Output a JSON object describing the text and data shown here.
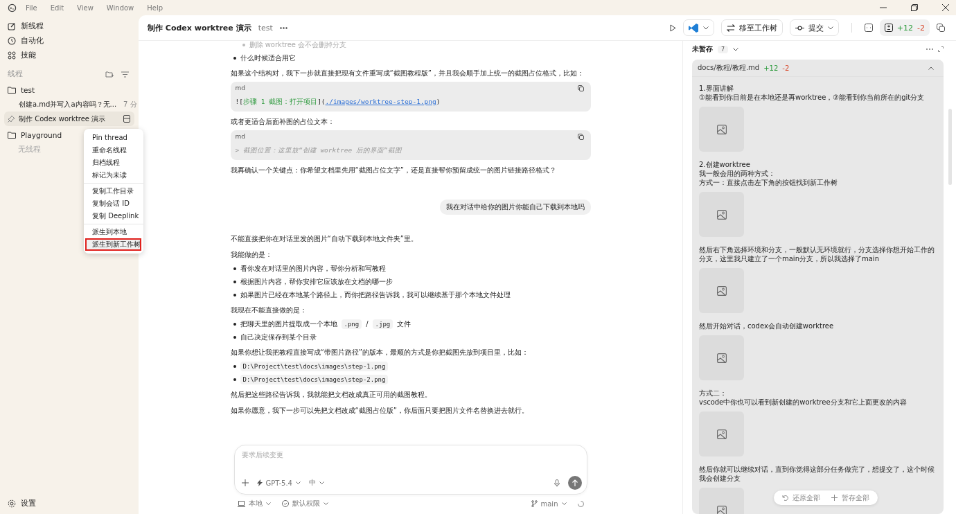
{
  "menu_bar": [
    "File",
    "Edit",
    "View",
    "Window",
    "Help"
  ],
  "sidebar": {
    "nav": [
      {
        "label": "新线程"
      },
      {
        "label": "自动化"
      },
      {
        "label": "技能"
      }
    ],
    "section_title": "线程",
    "projects": [
      {
        "name": "test",
        "threads": [
          {
            "title": "创建a.md并写入a内容吗？无...",
            "time": "7 分",
            "selected": false,
            "pinned": false
          },
          {
            "title": "制作 Codex worktree 演示",
            "selected": true,
            "pinned": true
          }
        ]
      },
      {
        "name": "Playground",
        "empty_text": "无线程"
      }
    ],
    "settings": "设置"
  },
  "context_menu": [
    [
      {
        "label": "Pin thread",
        "highlighted": false
      },
      {
        "label": "重命名线程",
        "highlighted": false
      },
      {
        "label": "归档线程",
        "highlighted": false
      },
      {
        "label": "标记为未读",
        "highlighted": false
      }
    ],
    [
      {
        "label": "复制工作目录",
        "highlighted": false
      },
      {
        "label": "复制会话 ID",
        "highlighted": false
      },
      {
        "label": "复制 Deeplink",
        "highlighted": false
      }
    ],
    [
      {
        "label": "派生到本地",
        "highlighted": false
      },
      {
        "label": "派生到新工作树",
        "highlighted": true
      }
    ]
  ],
  "header": {
    "title": "制作 Codex worktree 演示",
    "project": "test",
    "move_button": "移至工作树",
    "commit_button": "提交",
    "added": "+12",
    "removed": "-2"
  },
  "chat": [
    {
      "kind": "bullet",
      "faded": true,
      "indent": true,
      "text": "删除 worktree 会不会删掉分支"
    },
    {
      "kind": "bullet",
      "faded": false,
      "indent": false,
      "text": "什么时候适合用它"
    },
    {
      "kind": "paragraph",
      "text": "如果这个结构对，我下一步就直接把现有文件重写成“截图教程版”，并且我会顺手加上统一的截图占位格式，比如："
    },
    {
      "kind": "code",
      "lang": "md",
      "parts": [
        {
          "kind": "plain",
          "text": "!["
        },
        {
          "kind": "string",
          "text": "步骤 1 截图：打开项目"
        },
        {
          "kind": "plain",
          "text": "]("
        },
        {
          "kind": "link",
          "text": "./images/worktree-step-1.png"
        },
        {
          "kind": "plain",
          "text": ")"
        }
      ]
    },
    {
      "kind": "paragraph",
      "text": "或者更适合后面补图的占位文本："
    },
    {
      "kind": "code",
      "lang": "md",
      "parts": [
        {
          "kind": "comment",
          "text": "> 截图位置：这里放“创建 worktree 后的界面”截图"
        }
      ]
    },
    {
      "kind": "paragraph",
      "text": "我再确认一个关键点：你希望文档里先用“截图占位文字”，还是直接帮你预留成统一的图片链接路径格式？"
    },
    {
      "kind": "user",
      "text": "我在对话中给你的图片你能自己下载到本地吗"
    },
    {
      "kind": "paragraph",
      "text": "不能直接把你在对话里发的图片“自动下载到本地文件夹”里。"
    },
    {
      "kind": "paragraph",
      "text": "我能做的是："
    },
    {
      "kind": "bullet",
      "faded": false,
      "indent": false,
      "text": "看你发在对话里的图片内容，帮你分析和写教程"
    },
    {
      "kind": "bullet",
      "faded": false,
      "indent": false,
      "text": "根据图片内容，帮你安排它应该放在文档的哪一步"
    },
    {
      "kind": "bullet",
      "faded": false,
      "indent": false,
      "text": "如果图片已经在本地某个路径上，而你把路径告诉我，我可以继续基于那个本地文件处理"
    },
    {
      "kind": "paragraph",
      "text": "我现在不能直接做的是："
    },
    {
      "kind": "bullet",
      "faded": false,
      "indent": false,
      "parts": [
        {
          "code": false,
          "text": "把聊天里的图片提取成一个本地"
        },
        {
          "code": true,
          "text": ".png"
        },
        {
          "code": false,
          "text": "/"
        },
        {
          "code": true,
          "text": ".jpg"
        },
        {
          "code": false,
          "text": "文件"
        }
      ]
    },
    {
      "kind": "bullet",
      "faded": false,
      "indent": false,
      "text": "自己决定保存到某个目录"
    },
    {
      "kind": "paragraph",
      "text": "如果你想让我把教程直接写成“带图片路径”的版本，最顺的方式是你把截图先放到项目里，比如："
    },
    {
      "kind": "bullet",
      "faded": false,
      "indent": false,
      "parts": [
        {
          "code": true,
          "text": "D:\\Project\\test\\docs\\images\\step-1.png"
        }
      ]
    },
    {
      "kind": "bullet",
      "faded": false,
      "indent": false,
      "parts": [
        {
          "code": true,
          "text": "D:\\Project\\test\\docs\\images\\step-2.png"
        }
      ]
    },
    {
      "kind": "paragraph",
      "text": "然后把这些路径告诉我，我就能把文档改成真正可用的截图教程。"
    },
    {
      "kind": "paragraph",
      "text": "如果你愿意，我下一步可以先把文档改成“截图占位版”，你后面只要把图片文件名替换进去就行。"
    }
  ],
  "composer": {
    "placeholder": "要求后续变更",
    "model": "GPT-5.4",
    "effort": "中",
    "environment": "本地",
    "permission": "默认权限",
    "branch": "main"
  },
  "changes": {
    "title": "未暂存",
    "count": "7",
    "file": {
      "path": "docs/教程/教程.md",
      "added": "+12",
      "removed": "-2"
    },
    "content": [
      {
        "kind": "text",
        "text": "1.界面讲解"
      },
      {
        "kind": "text",
        "text": "①能看到你目前是在本地还是再worktree，②能看到你当前所在的git分支"
      },
      {
        "kind": "image"
      },
      {
        "kind": "text",
        "text": "2.创建worktree"
      },
      {
        "kind": "text",
        "text": "我一般会用的两种方式："
      },
      {
        "kind": "text",
        "text": "方式一：直接点击左下角的按钮找到新工作树"
      },
      {
        "kind": "image"
      },
      {
        "kind": "text",
        "text": "然后右下角选择环境和分支，一般默认无环境就行，分支选择你想开始工作的分支，这里我只建立了一个main分支，所以我选择了main"
      },
      {
        "kind": "image"
      },
      {
        "kind": "text",
        "text": "然后开始对话，codex会自动创建worktree"
      },
      {
        "kind": "image"
      },
      {
        "kind": "text",
        "text": "方式二："
      },
      {
        "kind": "text",
        "text": "vscode中你也可以看到新创建的worktree分支和它上面更改的内容"
      },
      {
        "kind": "image"
      },
      {
        "kind": "text",
        "text": "然后你就可以继续对话，直到你觉得这部分任务做完了，想提交了，这个时候我会创建分支"
      },
      {
        "kind": "image"
      }
    ],
    "revert_button": "还原全部",
    "stage_button": "暂存全部"
  }
}
